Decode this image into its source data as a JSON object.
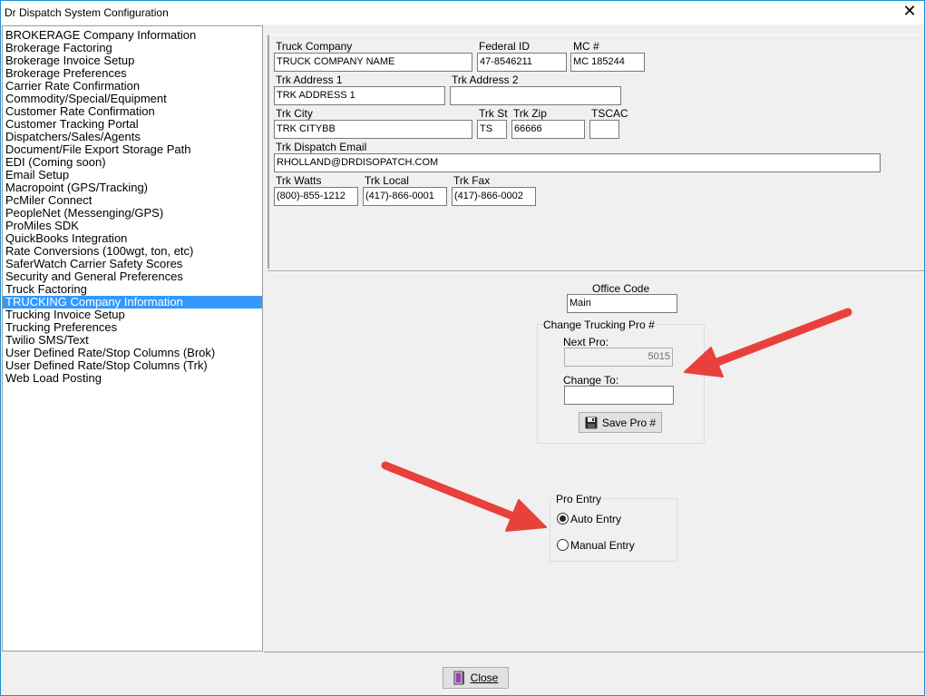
{
  "window": {
    "title": "Dr Dispatch  System Configuration",
    "close_glyph": "✕"
  },
  "sidebar": {
    "items": [
      "BROKERAGE Company Information",
      "Brokerage Factoring",
      "Brokerage Invoice Setup",
      "Brokerage Preferences",
      "Carrier Rate Confirmation",
      "Commodity/Special/Equipment",
      "Customer Rate Confirmation",
      "Customer Tracking Portal",
      "Dispatchers/Sales/Agents",
      "Document/File Export Storage Path",
      "EDI (Coming soon)",
      "Email Setup",
      "Macropoint (GPS/Tracking)",
      "PcMiler Connect",
      "PeopleNet (Messenging/GPS)",
      "ProMiles SDK",
      "QuickBooks Integration",
      "Rate Conversions (100wgt, ton, etc)",
      "SaferWatch Carrier Safety Scores",
      "Security and General Preferences",
      "Truck Factoring",
      "TRUCKING Company Information",
      "Trucking Invoice Setup",
      "Trucking Preferences",
      "Twilio SMS/Text",
      "User Defined Rate/Stop Columns (Brok)",
      "User Defined Rate/Stop Columns (Trk)",
      "Web Load Posting"
    ],
    "selected_index": 21
  },
  "company": {
    "truck_company_label": "Truck Company",
    "truck_company": "TRUCK COMPANY NAME",
    "federal_id_label": "Federal ID",
    "federal_id": "47-8546211",
    "mc_label": "MC #",
    "mc": "MC 185244",
    "address1_label": "Trk Address 1",
    "address1": "TRK ADDRESS 1",
    "address2_label": "Trk Address 2",
    "address2": "",
    "city_label": "Trk City",
    "city": "TRK CITYBB",
    "state_label": "Trk St",
    "state": "TS",
    "zip_label": "Trk Zip",
    "zip": "66666",
    "tscac_label": "TSCAC",
    "tscac": "",
    "email_label": "Trk Dispatch Email",
    "email": "RHOLLAND@DRDISOPATCH.COM",
    "watts_label": "Trk Watts",
    "watts": "(800)-855-1212",
    "local_label": "Trk Local",
    "local": "(417)-866-0001",
    "fax_label": "Trk Fax",
    "fax": "(417)-866-0002"
  },
  "office": {
    "label": "Office Code",
    "value": "Main"
  },
  "pro": {
    "group_title": "Change Trucking Pro #",
    "next_label": "Next Pro:",
    "next_value": "5015",
    "change_label": "Change To:",
    "change_value": "",
    "save_label": "Save Pro #",
    "save_icon": "floppy-disk-icon"
  },
  "pro_entry": {
    "group_title": "Pro Entry",
    "auto_label": "Auto Entry",
    "manual_label": "Manual Entry",
    "selected": "Auto Entry"
  },
  "footer": {
    "close_label": "Close",
    "close_icon": "door-exit-icon"
  },
  "colors": {
    "selection": "#3399ff",
    "arrow": "#e8413c",
    "window_border": "#1e8fd6"
  }
}
